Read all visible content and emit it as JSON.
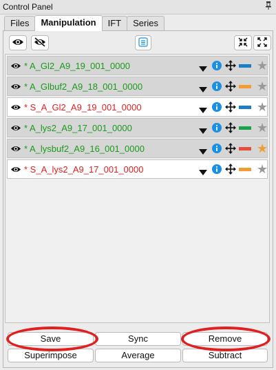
{
  "window": {
    "title": "Control Panel",
    "pin_icon": "pin-icon"
  },
  "tabs": [
    {
      "label": "Files",
      "active": false
    },
    {
      "label": "Manipulation",
      "active": true
    },
    {
      "label": "IFT",
      "active": false
    },
    {
      "label": "Series",
      "active": false
    }
  ],
  "toolbar": {
    "show_all_icon": "eye-icon",
    "hide_all_icon": "eye-slash-icon",
    "list_icon": "list-icon",
    "collapse_icon": "collapse-arrows-icon",
    "expand_icon": "expand-arrows-icon"
  },
  "items": [
    {
      "name": "* A_Gl2_A9_19_001_0000",
      "color": "#1a9a1a",
      "swatch": "#1a7fc4",
      "star": "#999999",
      "selected": true
    },
    {
      "name": "* A_Glbuf2_A9_18_001_0000",
      "color": "#1a9a1a",
      "swatch": "#f39c33",
      "star": "#999999",
      "selected": true
    },
    {
      "name": "* S_A_Gl2_A9_19_001_0000",
      "color": "#e02020",
      "swatch": "#1a7fc4",
      "star": "#999999",
      "selected": false
    },
    {
      "name": "* A_lys2_A9_17_001_0000",
      "color": "#1a9a1a",
      "swatch": "#1aa34a",
      "star": "#999999",
      "selected": true
    },
    {
      "name": "* A_lysbuf2_A9_16_001_0000",
      "color": "#1a9a1a",
      "swatch": "#e84c3d",
      "star": "#f39c33",
      "selected": true
    },
    {
      "name": "* S_A_lys2_A9_17_001_0000",
      "color": "#e02020",
      "swatch": "#f39c33",
      "star": "#999999",
      "selected": false
    }
  ],
  "buttons": {
    "save": "Save",
    "sync": "Sync",
    "remove": "Remove",
    "superimpose": "Superimpose",
    "average": "Average",
    "subtract": "Subtract"
  },
  "colors": {
    "accent_red": "#e02020",
    "info_blue": "#1a8fe3"
  }
}
